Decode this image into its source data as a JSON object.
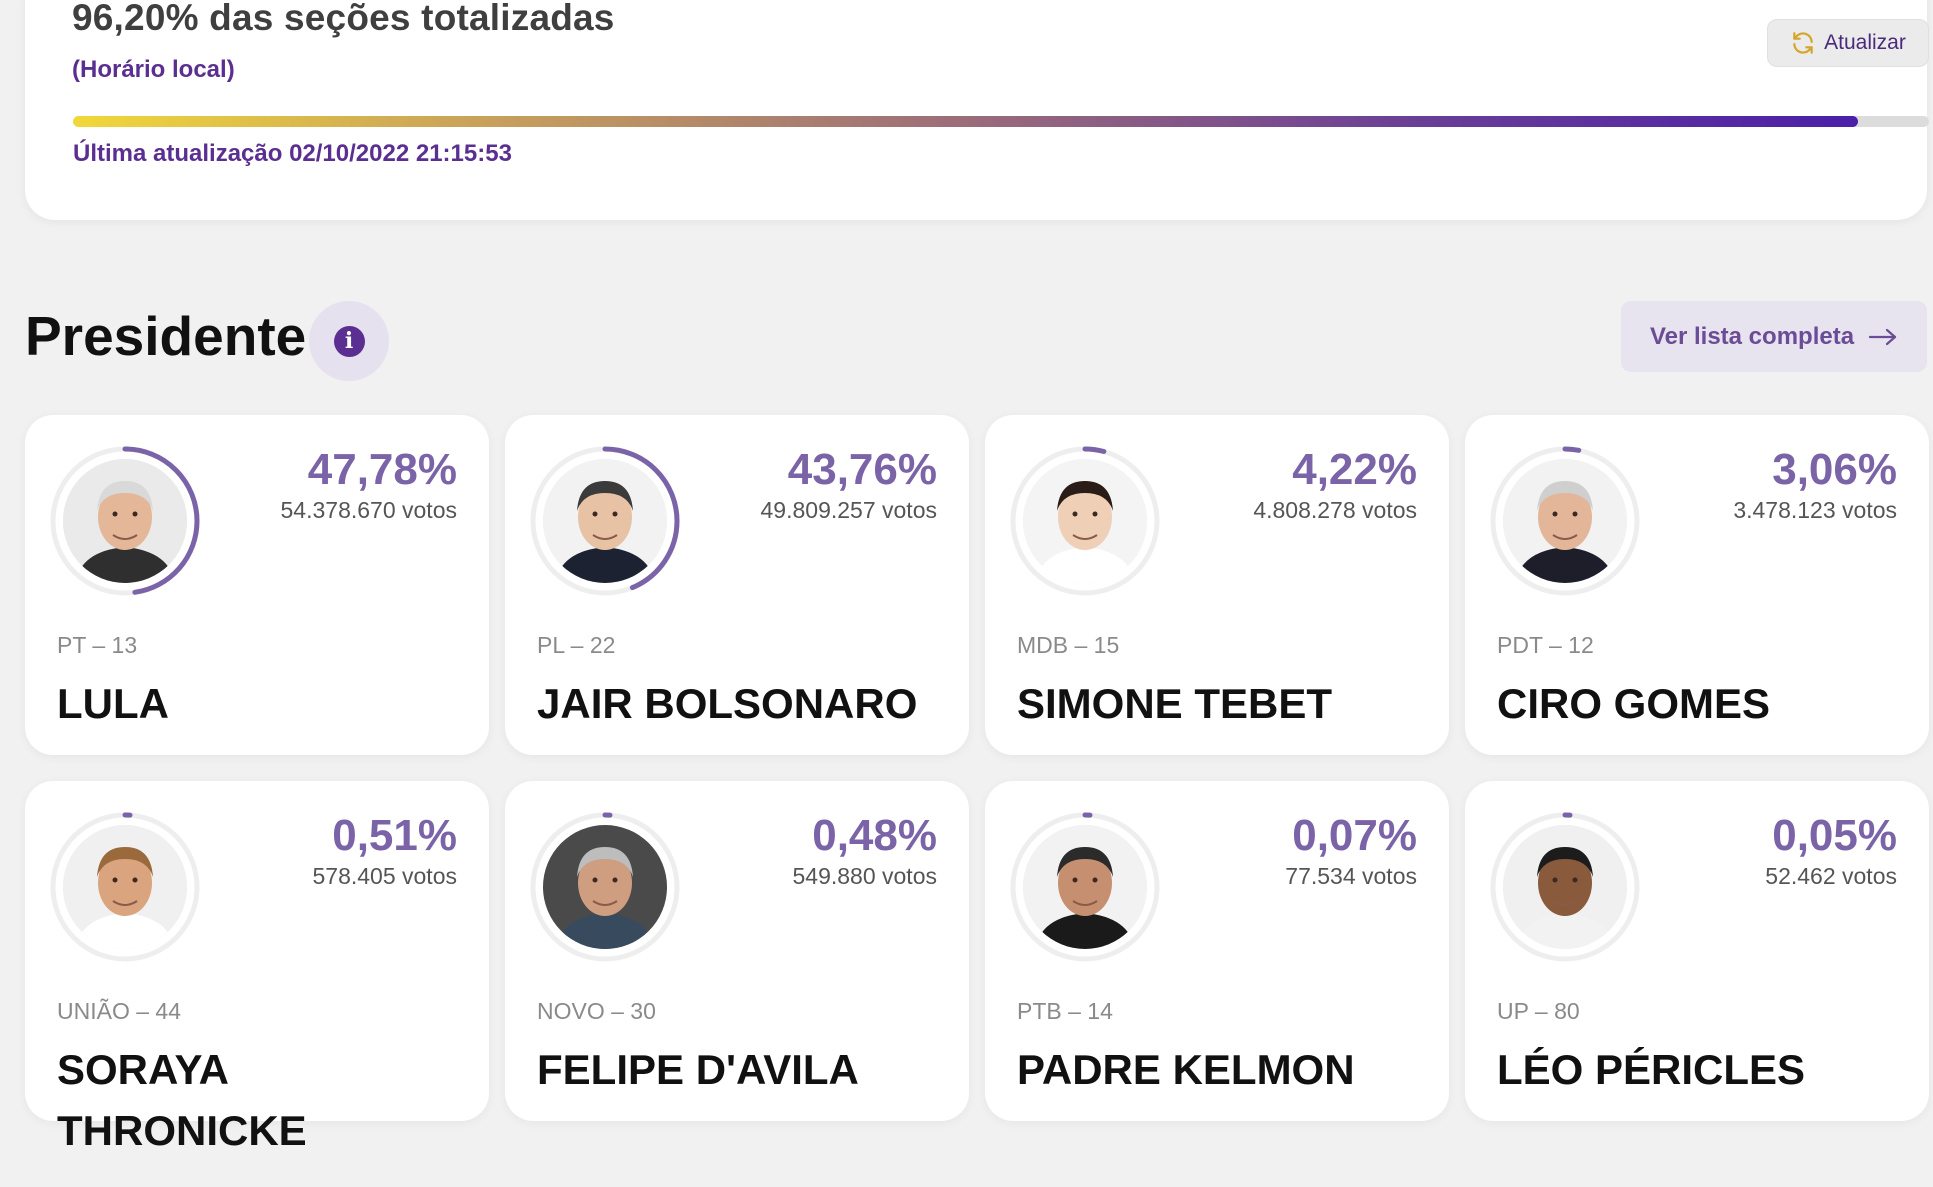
{
  "status": {
    "title": "96,20% das seções totalizadas",
    "subtitle": "(Horário local)",
    "refresh_label": "Atualizar",
    "progress_fraction": 0.962,
    "last_update": "Última atualização 02/10/2022 21:15:53"
  },
  "section": {
    "title": "Presidente",
    "info_icon": "info-icon",
    "full_list_label": "Ver lista completa"
  },
  "colors": {
    "accent": "#5b2f91",
    "ring": "#7b63a8",
    "percent": "#7b63a8"
  },
  "candidates": [
    {
      "name": "LULA",
      "party": "PT – 13",
      "percent": "47,78%",
      "votes": "54.378.670 votos",
      "share": 0.4778
    },
    {
      "name": "JAIR BOLSONARO",
      "party": "PL – 22",
      "percent": "43,76%",
      "votes": "49.809.257 votos",
      "share": 0.4376
    },
    {
      "name": "SIMONE TEBET",
      "party": "MDB – 15",
      "percent": "4,22%",
      "votes": "4.808.278 votos",
      "share": 0.0422
    },
    {
      "name": "CIRO GOMES",
      "party": "PDT – 12",
      "percent": "3,06%",
      "votes": "3.478.123 votos",
      "share": 0.0306
    },
    {
      "name": "SORAYA THRONICKE",
      "party": "UNIÃO – 44",
      "percent": "0,51%",
      "votes": "578.405 votos",
      "share": 0.0051
    },
    {
      "name": "FELIPE D'AVILA",
      "party": "NOVO – 30",
      "percent": "0,48%",
      "votes": "549.880 votos",
      "share": 0.0048
    },
    {
      "name": "PADRE KELMON",
      "party": "PTB – 14",
      "percent": "0,07%",
      "votes": "77.534 votos",
      "share": 0.0007
    },
    {
      "name": "LÉO PÉRICLES",
      "party": "UP – 80",
      "percent": "0,05%",
      "votes": "52.462 votos",
      "share": 0.0005
    }
  ]
}
